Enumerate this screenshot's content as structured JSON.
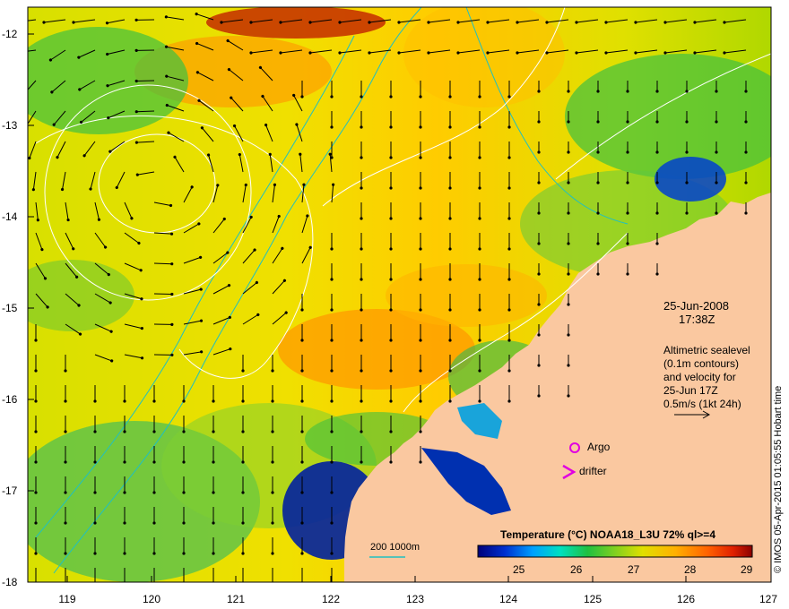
{
  "map": {
    "lon_ticks": [
      "119",
      "120",
      "121",
      "122",
      "123",
      "124",
      "125",
      "126",
      "127"
    ],
    "lat_ticks": [
      "-12",
      "-13",
      "-14",
      "-15",
      "-16",
      "-17",
      "-18"
    ]
  },
  "annotation": {
    "date": "25-Jun-2008",
    "time": "17:38Z",
    "legend_lines": [
      "Altimetric sealevel",
      "(0.1m contours)",
      "and velocity for",
      "25-Jun 17Z",
      "0.5m/s (1kt 24h)"
    ]
  },
  "markers": {
    "argo_label": "Argo",
    "drifter_label": "drifter",
    "argo_color": "#e000e0",
    "drifter_color": "#e000e0"
  },
  "depth_legend": {
    "label": "200  1000m",
    "color": "#20c0c0"
  },
  "colorbar": {
    "title": "Temperature (°C) NOAA18_L3U 72% ql>=4",
    "ticks": [
      "25",
      "26",
      "27",
      "28",
      "29"
    ],
    "colors": [
      "#00007a",
      "#0030d0",
      "#00a0ff",
      "#00e0c0",
      "#20c040",
      "#80d020",
      "#e0e000",
      "#ffb000",
      "#ff6000",
      "#e02000",
      "#8a0000"
    ]
  },
  "credit": "© IMOS 05-Apr-2015 01:05:55 Hobart time",
  "colors": {
    "land": "#fac8a0",
    "contour": "#ffffff",
    "arrow": "#000000"
  }
}
